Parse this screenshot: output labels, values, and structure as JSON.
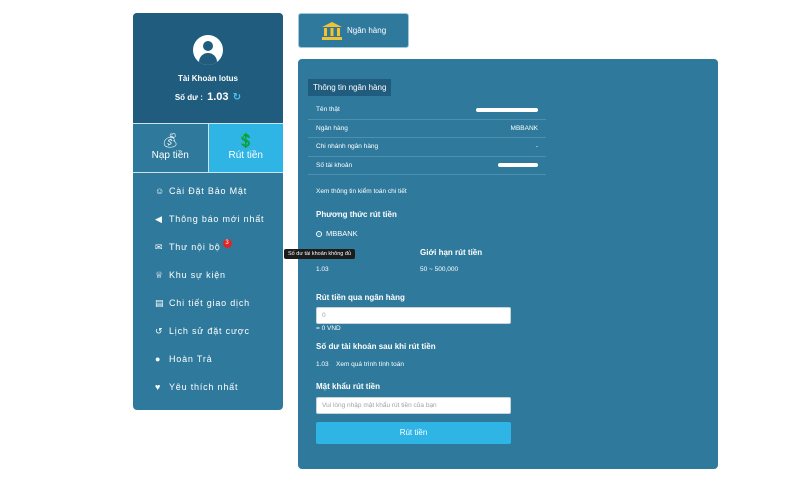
{
  "profile": {
    "username": "Tài Khoản lotus",
    "balance_label": "Số dư :",
    "balance_value": "1.03"
  },
  "actions": {
    "deposit_label": "Nạp tiền",
    "withdraw_label": "Rút tiền"
  },
  "menu": [
    {
      "label": "Cài Đặt Bảo Mật",
      "icon": "user-gear-icon"
    },
    {
      "label": "Thông báo mới nhất",
      "icon": "megaphone-icon"
    },
    {
      "label": "Thư nội bộ",
      "icon": "envelope-icon",
      "badge": "3"
    },
    {
      "label": "Khu sự kiện",
      "icon": "trophy-icon"
    },
    {
      "label": "Chi tiết giao dịch",
      "icon": "clipboard-icon"
    },
    {
      "label": "Lịch sử đặt cược",
      "icon": "history-icon"
    },
    {
      "label": "Hoàn Trả",
      "icon": "coin-icon"
    },
    {
      "label": "Yêu thích nhất",
      "icon": "heart-icon"
    }
  ],
  "tab": {
    "label": "Ngân hàng",
    "icon": "bank-icon"
  },
  "bank_info": {
    "title": "Thông tin ngân hàng",
    "rows": [
      {
        "label": "Tên thật",
        "value": ""
      },
      {
        "label": "Ngân hàng",
        "value": "MBBANK"
      },
      {
        "label": "Chi nhánh ngân hàng",
        "value": "-"
      },
      {
        "label": "Số tài khoản",
        "value": ""
      }
    ],
    "audit_link": "Xem thông tin kiểm toán chi tiết"
  },
  "withdraw_method": {
    "title": "Phương thức rút tiền",
    "option": "MBBANK",
    "balance_value": "1.03",
    "limit_title": "Giới hạn rút tiền",
    "limit_value": "50 ~ 500,000"
  },
  "tooltip": "Số dư tài khoản không đủ",
  "amount": {
    "title": "Rút tiền qua ngân hàng",
    "value": "0",
    "converted": "= 0 VND"
  },
  "after_balance": {
    "title": "Số dư tài khoản sau khi rút tiền",
    "value": "1.03",
    "link": "Xem quá trình tính toán"
  },
  "password": {
    "title": "Mật khẩu rút tiền",
    "placeholder": "Vui lòng nhập mật khẩu rút tiền của bạn"
  },
  "submit_label": "Rút tiền",
  "colors": {
    "panel": "#2f7a9c",
    "profile_bg": "#1f5c7d",
    "accent": "#2eb4e5",
    "badge": "#e02424"
  }
}
